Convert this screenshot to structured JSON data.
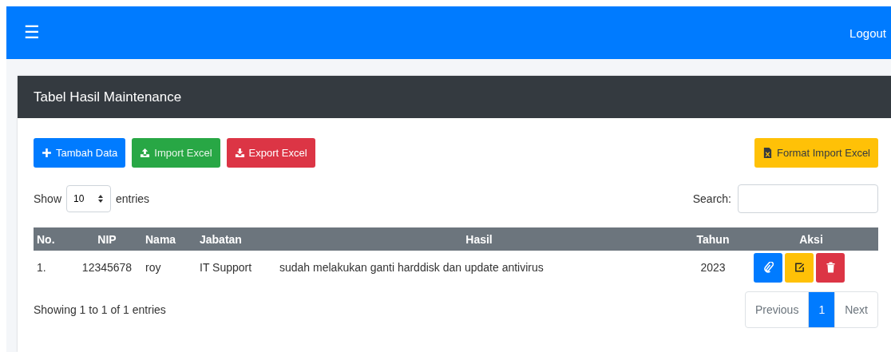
{
  "navbar": {
    "menu_icon": "☰",
    "logout": "Logout"
  },
  "card": {
    "title": "Tabel Hasil Maintenance"
  },
  "toolbar": {
    "buttons": [
      {
        "label": "Tambah Data",
        "kind": "add"
      },
      {
        "label": "Import Excel",
        "kind": "import"
      },
      {
        "label": "Export Excel",
        "kind": "export"
      }
    ],
    "format_button": "Format Import Excel"
  },
  "length": {
    "before": "Show",
    "value": "10",
    "after": "entries"
  },
  "search": {
    "label": "Search:"
  },
  "table": {
    "columns": [
      "No.",
      "NIP",
      "Nama",
      "Jabatan",
      "Hasil",
      "Tahun",
      "Aksi"
    ],
    "rows": [
      {
        "cells": [
          "1.",
          "12345678",
          "roy",
          "IT Support",
          "sudah melakukan ganti harddisk dan update antivirus",
          "2023"
        ]
      }
    ]
  },
  "info": "Showing 1 to 1 of 1 entries",
  "pagination": [
    {
      "label": "Previous",
      "selected": false
    },
    {
      "label": "1",
      "selected": true
    },
    {
      "label": "Next",
      "selected": false
    }
  ]
}
